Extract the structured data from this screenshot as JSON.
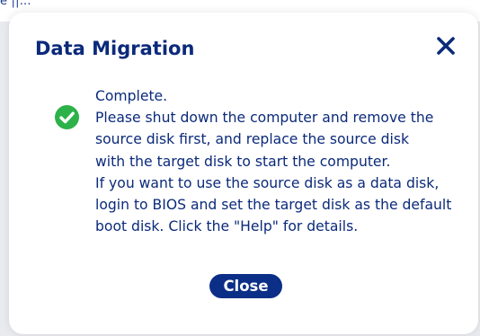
{
  "background": {
    "partial_text": "e ||..."
  },
  "dialog": {
    "title": "Data Migration",
    "close_icon": "close-icon",
    "status_icon": "check-circle-icon",
    "message_lines": [
      "Complete.",
      "Please shut down the computer and remove the",
      "source disk first, and replace the source disk",
      "with the target disk to start the computer.",
      "If you want to use the source disk as a data disk,",
      "login to BIOS and set the target disk as the default",
      "boot disk. Click the \"Help\" for details."
    ],
    "close_button_label": "Close"
  },
  "colors": {
    "title_text": "#0b2a7a",
    "body_text": "#0b2a7a",
    "button_bg": "#0b2f86",
    "button_text": "#ffffff",
    "success_green": "#2db24a",
    "backdrop": "#e9ebef"
  }
}
